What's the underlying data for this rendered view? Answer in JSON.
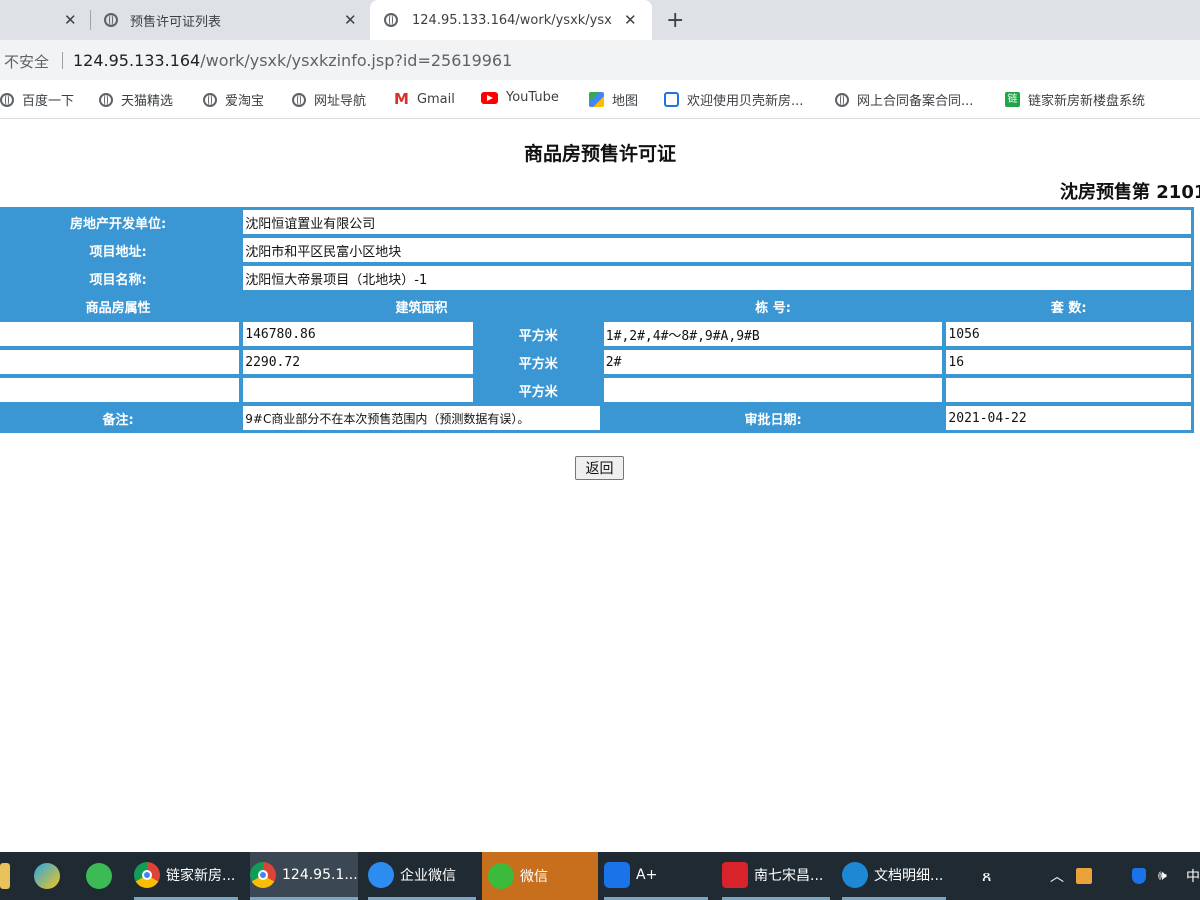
{
  "browser": {
    "tabs": [
      {
        "title": "",
        "close": "✕"
      },
      {
        "title": "预售许可证列表",
        "close": "✕"
      },
      {
        "title": "124.95.133.164/work/ysxk/ysxk",
        "close": "✕"
      }
    ],
    "new_tab": "+",
    "address": {
      "security": "不安全",
      "host": "124.95.133.164",
      "path": "/work/ysxk/ysxkzinfo.jsp?id=25619961"
    },
    "bookmarks": [
      {
        "label": "百度一下",
        "icon": "globe-icon"
      },
      {
        "label": "天猫精选",
        "icon": "globe-icon"
      },
      {
        "label": "爱淘宝",
        "icon": "globe-icon"
      },
      {
        "label": "网址导航",
        "icon": "globe-icon"
      },
      {
        "label": "Gmail",
        "icon": "gmail-icon"
      },
      {
        "label": "YouTube",
        "icon": "youtube-icon"
      },
      {
        "label": "地图",
        "icon": "map-icon"
      },
      {
        "label": "欢迎使用贝壳新房...",
        "icon": "beike-icon"
      },
      {
        "label": "网上合同备案合同...",
        "icon": "globe-icon"
      },
      {
        "label": "链家新房新楼盘系统",
        "icon": "lianjia-icon"
      }
    ]
  },
  "page": {
    "title": "商品房预售许可证",
    "permit_number": "沈房预售第 2101",
    "developer_label": "房地产开发单位:",
    "developer": "沈阳恒谊置业有限公司",
    "address_label": "项目地址:",
    "address": "沈阳市和平区民富小区地块",
    "project_label": "项目名称:",
    "project": "沈阳恒大帝景项目（北地块）-1",
    "headers": {
      "property_type": "商品房属性",
      "area": "建筑面积",
      "building": "栋 号:",
      "units": "套 数:"
    },
    "unit_label": "平方米",
    "rows": [
      {
        "type": "",
        "area": "146780.86",
        "building": "1#,2#,4#～8#,9#A,9#B",
        "units": "1056"
      },
      {
        "type": "",
        "area": "2290.72",
        "building": "2#",
        "units": "16"
      },
      {
        "type": "",
        "area": "",
        "building": "",
        "units": ""
      }
    ],
    "remark_label": "备注:",
    "remark": "9#C商业部分不在本次预售范围内（预测数据有误）。",
    "approval_label": "审批日期:",
    "approval_date": "2021-04-22",
    "back_button": "返回"
  },
  "taskbar": {
    "items": [
      {
        "label": "",
        "icon": "app-icon"
      },
      {
        "label": "",
        "icon": "media-player-icon"
      },
      {
        "label": "",
        "icon": "green-app-icon"
      },
      {
        "label": "链家新房...",
        "icon": "chrome-icon"
      },
      {
        "label": "124.95.1...",
        "icon": "chrome-icon"
      },
      {
        "label": "企业微信",
        "icon": "wecom-icon"
      },
      {
        "label": "微信",
        "icon": "wechat-icon"
      },
      {
        "label": "A+",
        "icon": "aplus-icon"
      },
      {
        "label": "南七宋昌...",
        "icon": "wps-icon"
      },
      {
        "label": "文档明细...",
        "icon": "ie-icon"
      }
    ],
    "tray": {
      "ime": "中",
      "volume": "🕪",
      "up": "︿"
    }
  },
  "colors": {
    "table_blue": "#3a97d4",
    "taskbar": "#1f2a33",
    "wechat_active": "#c86f1e"
  }
}
